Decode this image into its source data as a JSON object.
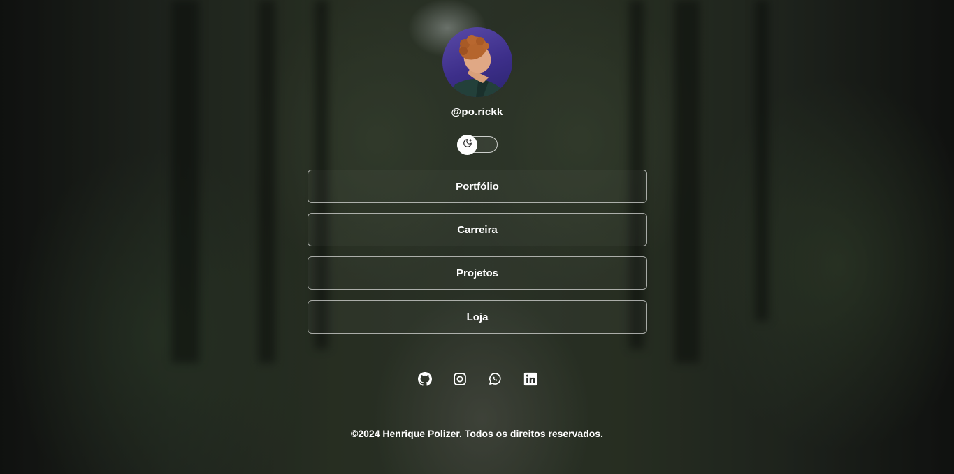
{
  "profile": {
    "username": "@po.rickk"
  },
  "theme_toggle": {
    "icon": "moon-icon"
  },
  "links": [
    {
      "label": "Portfólio"
    },
    {
      "label": "Carreira"
    },
    {
      "label": "Projetos"
    },
    {
      "label": "Loja"
    }
  ],
  "socials": [
    {
      "icon": "github-icon"
    },
    {
      "icon": "instagram-icon"
    },
    {
      "icon": "whatsapp-icon"
    },
    {
      "icon": "linkedin-icon"
    }
  ],
  "footer": {
    "text": "©2024 Henrique Polizer. Todos os direitos reservados."
  }
}
